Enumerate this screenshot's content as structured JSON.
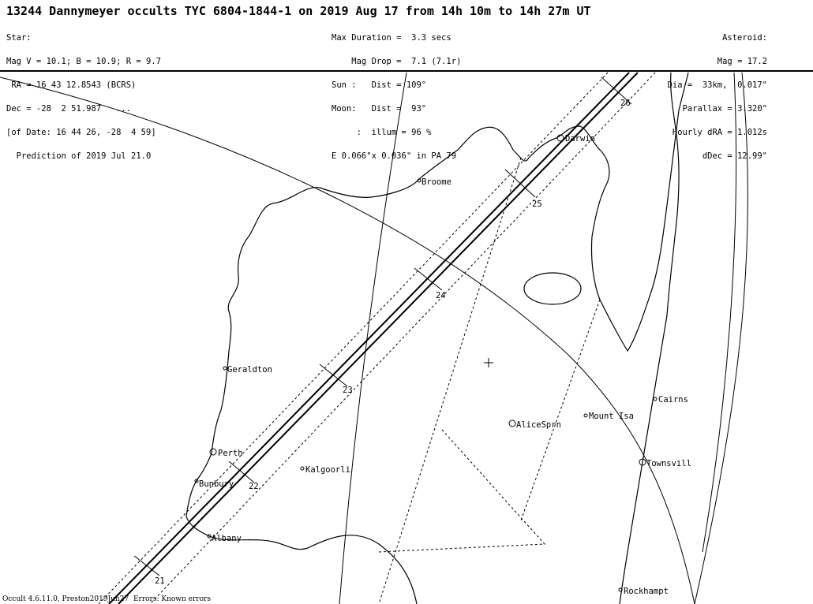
{
  "title": "13244 Dannymeyer occults TYC 6804-1844-1 on 2019 Aug 17 from 14h 10m to 14h 27m UT",
  "star": {
    "lines": [
      "Star:",
      "Mag V = 10.1; B = 10.9; R = 9.7",
      " RA = 16 43 12.8543 (BCRS)",
      "Dec = -28  2 51.987   ...",
      "[of Date: 16 44 26, -28  4 59]",
      "  Prediction of 2019 Jul 21.0"
    ]
  },
  "event": {
    "lines": [
      "Max Duration =  3.3 secs",
      "    Mag Drop =  7.1 (7.1r)",
      "Sun :   Dist = 109°",
      "Moon:   Dist =  93°",
      "     :  illum = 96 %",
      "E 0.066\"x 0.036\" in PA 79"
    ]
  },
  "asteroid": {
    "lines": [
      "Asteroid:",
      "Mag = 17.2",
      "Dia =  33km,  0.017\"",
      "Parallax = 3.320\"",
      "Hourly dRA = 1.012s",
      "dDec = 12.99\""
    ]
  },
  "cities": [
    {
      "name": "Broome",
      "id": "broome"
    },
    {
      "name": "Darwin",
      "id": "darwin"
    },
    {
      "name": "Geraldton",
      "id": "geraldton"
    },
    {
      "name": "AliceSprn",
      "id": "alice-springs"
    },
    {
      "name": "Mount Isa",
      "id": "mount-isa"
    },
    {
      "name": "Cairns",
      "id": "cairns"
    },
    {
      "name": "Perth",
      "id": "perth"
    },
    {
      "name": "Bunbury",
      "id": "bunbury"
    },
    {
      "name": "Kalgoorli",
      "id": "kalgoorlie"
    },
    {
      "name": "Townsvill",
      "id": "townsville"
    },
    {
      "name": "Albany",
      "id": "albany"
    },
    {
      "name": "Rockhampt",
      "id": "rockhampton"
    }
  ],
  "time_ticks": [
    "26",
    "25",
    "24",
    "23",
    "22",
    "21"
  ],
  "footer": "Occult 4.6.11.0, Preston2019Jun27  Errors: Known errors"
}
